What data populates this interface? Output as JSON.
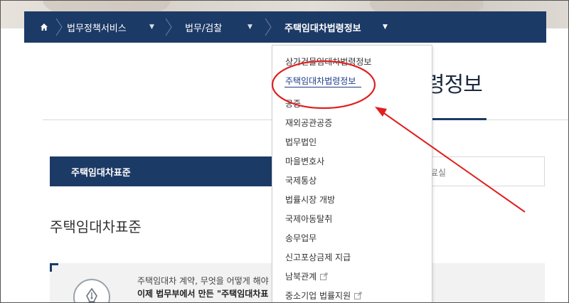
{
  "nav": {
    "items": [
      {
        "label": "법무정책서비스"
      },
      {
        "label": "법무/검찰"
      },
      {
        "label": "주택임대차법령정보"
      }
    ]
  },
  "page": {
    "title_partial": "령정보",
    "tab_active": "주택임대차표준",
    "tab_partial": "료실",
    "section_title": "주택임대차표준",
    "info_line1": "주택임대차 계약, 무엇을 어떻게 해야",
    "info_line2": "이제 법무부에서 만든 \"주택임대차표"
  },
  "dropdown": {
    "items": [
      {
        "label": "상가건물임대차법령정보",
        "external": false
      },
      {
        "label": "주택임대차법령정보",
        "external": false,
        "active": true
      },
      {
        "label": "공증",
        "external": false
      },
      {
        "label": "재외공관공증",
        "external": false
      },
      {
        "label": "법무법인",
        "external": false
      },
      {
        "label": "마을변호사",
        "external": false
      },
      {
        "label": "국제통상",
        "external": false
      },
      {
        "label": "법률시장 개방",
        "external": false
      },
      {
        "label": "국제아동탈취",
        "external": false
      },
      {
        "label": "송무업무",
        "external": false
      },
      {
        "label": "신고포상금제 지급",
        "external": false
      },
      {
        "label": "남북관계",
        "external": true
      },
      {
        "label": "중소기업 법률지원",
        "external": true
      }
    ]
  },
  "icons": {
    "home": "home-icon",
    "caret": "caret-down-icon",
    "separator": "chevron-right-icon",
    "external": "external-link-icon",
    "pen": "fountain-pen-icon"
  },
  "colors": {
    "nav_bg": "#1c3a66",
    "active_link": "#1c3a8a",
    "annotation": "#e02020"
  }
}
